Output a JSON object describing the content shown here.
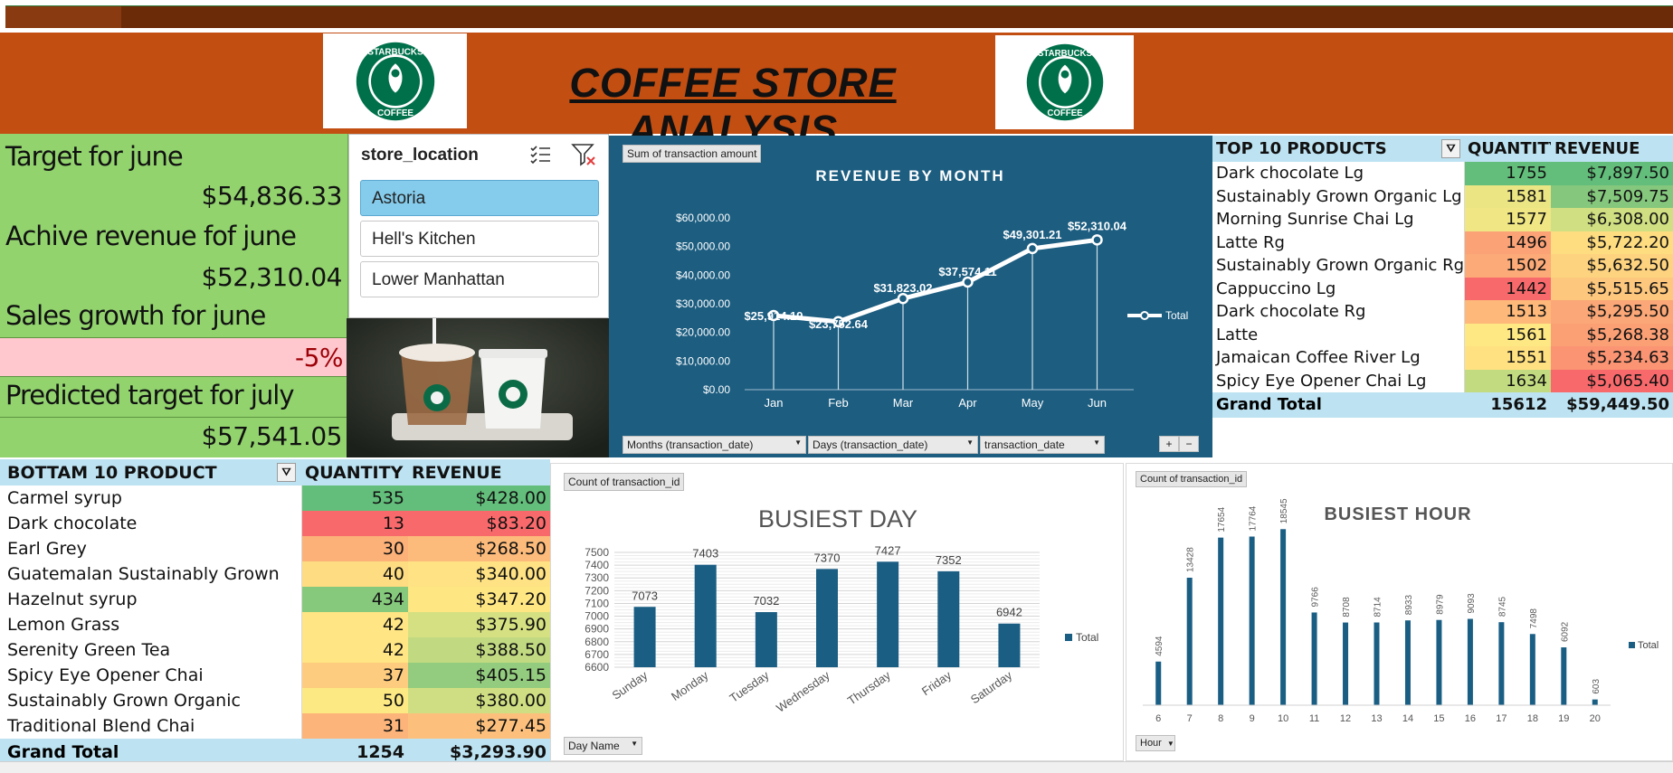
{
  "header": {
    "title": "COFFEE STORE ANALYSIS",
    "logo_text_top": "STARBUCKS",
    "logo_text_bottom": "COFFEE"
  },
  "kpis": {
    "target_label": "Target for june",
    "target_value": "$54,836.33",
    "achieved_label": "Achive revenue fof june",
    "achieved_value": "$52,310.04",
    "growth_label": "Sales growth for june",
    "growth_value": "-5%",
    "predicted_label": "Predicted target for july",
    "predicted_value": "$57,541.05"
  },
  "slicer": {
    "title": "store_location",
    "items": [
      "Astoria",
      "Hell's Kitchen",
      "Lower Manhattan"
    ],
    "selected": "Astoria"
  },
  "revenue_panel": {
    "field_tag": "Sum of transaction amount",
    "filters": [
      "Months (transaction_date)",
      "Days (transaction_date)",
      "transaction_date"
    ],
    "zoom_plus": "+",
    "zoom_minus": "−"
  },
  "top10": {
    "headers": [
      "TOP 10 PRODUCTS",
      "QUANTITY",
      "REVENUE"
    ],
    "rows": [
      {
        "name": "Dark chocolate Lg",
        "qty": "1755",
        "rev": "$7,897.50",
        "qty_color": "#63be7b",
        "rev_color": "#63be7b"
      },
      {
        "name": "Sustainably Grown Organic Lg",
        "qty": "1581",
        "rev": "$7,509.75",
        "qty_color": "#ebe583",
        "rev_color": "#85c87d"
      },
      {
        "name": "Morning Sunrise Chai Lg",
        "qty": "1577",
        "rev": "$6,308.00",
        "qty_color": "#f0e684",
        "rev_color": "#cfdf82"
      },
      {
        "name": "Latte Rg",
        "qty": "1496",
        "rev": "$5,722.20",
        "qty_color": "#fba276",
        "rev_color": "#fedd81"
      },
      {
        "name": "Sustainably Grown Organic Rg",
        "qty": "1502",
        "rev": "$5,632.50",
        "qty_color": "#fcaa78",
        "rev_color": "#fed380"
      },
      {
        "name": "Cappuccino Lg",
        "qty": "1442",
        "rev": "$5,515.65",
        "qty_color": "#f8696b",
        "rev_color": "#fdc77d"
      },
      {
        "name": "Dark chocolate Rg",
        "qty": "1513",
        "rev": "$5,295.50",
        "qty_color": "#fdb87a",
        "rev_color": "#fba777"
      },
      {
        "name": "Latte",
        "qty": "1561",
        "rev": "$5,268.38",
        "qty_color": "#fee883",
        "rev_color": "#fb9f75"
      },
      {
        "name": "Jamaican Coffee River Lg",
        "qty": "1551",
        "rev": "$5,234.63",
        "qty_color": "#ffe182",
        "rev_color": "#fa9473"
      },
      {
        "name": "Spicy Eye Opener Chai Lg",
        "qty": "1634",
        "rev": "$5,065.40",
        "qty_color": "#c2db80",
        "rev_color": "#f8696b"
      }
    ],
    "total": {
      "label": "Grand Total",
      "qty": "15612",
      "rev": "$59,449.50"
    }
  },
  "bottom10": {
    "headers": [
      "BOTTAM 10 PRODUCT",
      "QUANTITY",
      "REVENUE"
    ],
    "rows": [
      {
        "name": "Carmel syrup",
        "qty": "535",
        "rev": "$428.00",
        "qty_color": "#63be7b",
        "rev_color": "#63be7b"
      },
      {
        "name": "Dark chocolate",
        "qty": "13",
        "rev": "$83.20",
        "qty_color": "#f8696b",
        "rev_color": "#f8696b"
      },
      {
        "name": "Earl Grey",
        "qty": "30",
        "rev": "$268.50",
        "qty_color": "#fcb179",
        "rev_color": "#fcbb7b"
      },
      {
        "name": "Guatemalan Sustainably Grown",
        "qty": "40",
        "rev": "$340.00",
        "qty_color": "#fedc81",
        "rev_color": "#fee283"
      },
      {
        "name": "Hazelnut syrup",
        "qty": "434",
        "rev": "$347.20",
        "qty_color": "#86c97d",
        "rev_color": "#fee683"
      },
      {
        "name": "Lemon Grass",
        "qty": "42",
        "rev": "$375.90",
        "qty_color": "#ffe583",
        "rev_color": "#d5e082"
      },
      {
        "name": "Serenity Green Tea",
        "qty": "42",
        "rev": "$388.50",
        "qty_color": "#ffe583",
        "rev_color": "#c1da81"
      },
      {
        "name": "Spicy Eye Opener Chai",
        "qty": "37",
        "rev": "$405.15",
        "qty_color": "#fdcc7e",
        "rev_color": "#93cc7e"
      },
      {
        "name": "Sustainably Grown Organic",
        "qty": "50",
        "rev": "$380.00",
        "qty_color": "#fde983",
        "rev_color": "#cfde82"
      },
      {
        "name": "Traditional Blend Chai",
        "qty": "31",
        "rev": "$277.45",
        "qty_color": "#fcb47a",
        "rev_color": "#fcc07c"
      }
    ],
    "total": {
      "label": "Grand Total",
      "qty": "1254",
      "rev": "$3,293.90"
    }
  },
  "day_panel": {
    "field_tag": "Count of transaction_id",
    "filter": "Day Name"
  },
  "hour_panel": {
    "field_tag": "Count of transaction_id",
    "filter": "Hour"
  },
  "colors": {
    "header_band": "#c24e12",
    "kpi_green": "#92d36e",
    "growth_pink": "#ffc7ce",
    "growth_text": "#9c0006",
    "revenue_panel": "#1c5d80",
    "bar_blue": "#1a5e84",
    "table_header": "#bde3f2",
    "slicer_selected": "#85ccec"
  },
  "chart_data": [
    {
      "type": "line",
      "title": "REVENUE BY MONTH",
      "categories": [
        "Jan",
        "Feb",
        "Mar",
        "Apr",
        "May",
        "Jun"
      ],
      "series": [
        {
          "name": "Total",
          "values": [
            25914.19,
            23752.64,
            31823.02,
            37574.11,
            49301.21,
            52310.04
          ]
        }
      ],
      "data_labels": [
        "$25,914.19",
        "$23,752.64",
        "$31,823.02",
        "$37,574.11",
        "$49,301.21",
        "$52,310.04"
      ],
      "yticks": [
        "$0.00",
        "$10,000.00",
        "$20,000.00",
        "$30,000.00",
        "$40,000.00",
        "$50,000.00",
        "$60,000.00"
      ],
      "ylim": [
        0,
        60000
      ],
      "legend": "right"
    },
    {
      "type": "bar",
      "title": "BUSIEST DAY",
      "categories": [
        "Sunday",
        "Monday",
        "Tuesday",
        "Wednesday",
        "Thursday",
        "Friday",
        "Saturday"
      ],
      "series": [
        {
          "name": "Total",
          "values": [
            7073,
            7403,
            7032,
            7370,
            7427,
            7352,
            6942
          ]
        }
      ],
      "yticks": [
        "6600",
        "6700",
        "6800",
        "6900",
        "7000",
        "7100",
        "7200",
        "7300",
        "7400",
        "7500"
      ],
      "ylim": [
        6600,
        7500
      ],
      "grid": true,
      "legend": "right"
    },
    {
      "type": "bar",
      "title": "BUSIEST HOUR",
      "categories": [
        "6",
        "7",
        "8",
        "9",
        "10",
        "11",
        "12",
        "13",
        "14",
        "15",
        "16",
        "17",
        "18",
        "19",
        "20"
      ],
      "series": [
        {
          "name": "Total",
          "values": [
            4594,
            13428,
            17654,
            17764,
            18545,
            9766,
            8708,
            8714,
            8933,
            8979,
            9093,
            8745,
            7498,
            6092,
            603
          ]
        }
      ],
      "ylim": [
        0,
        20000
      ],
      "legend": "right"
    }
  ]
}
